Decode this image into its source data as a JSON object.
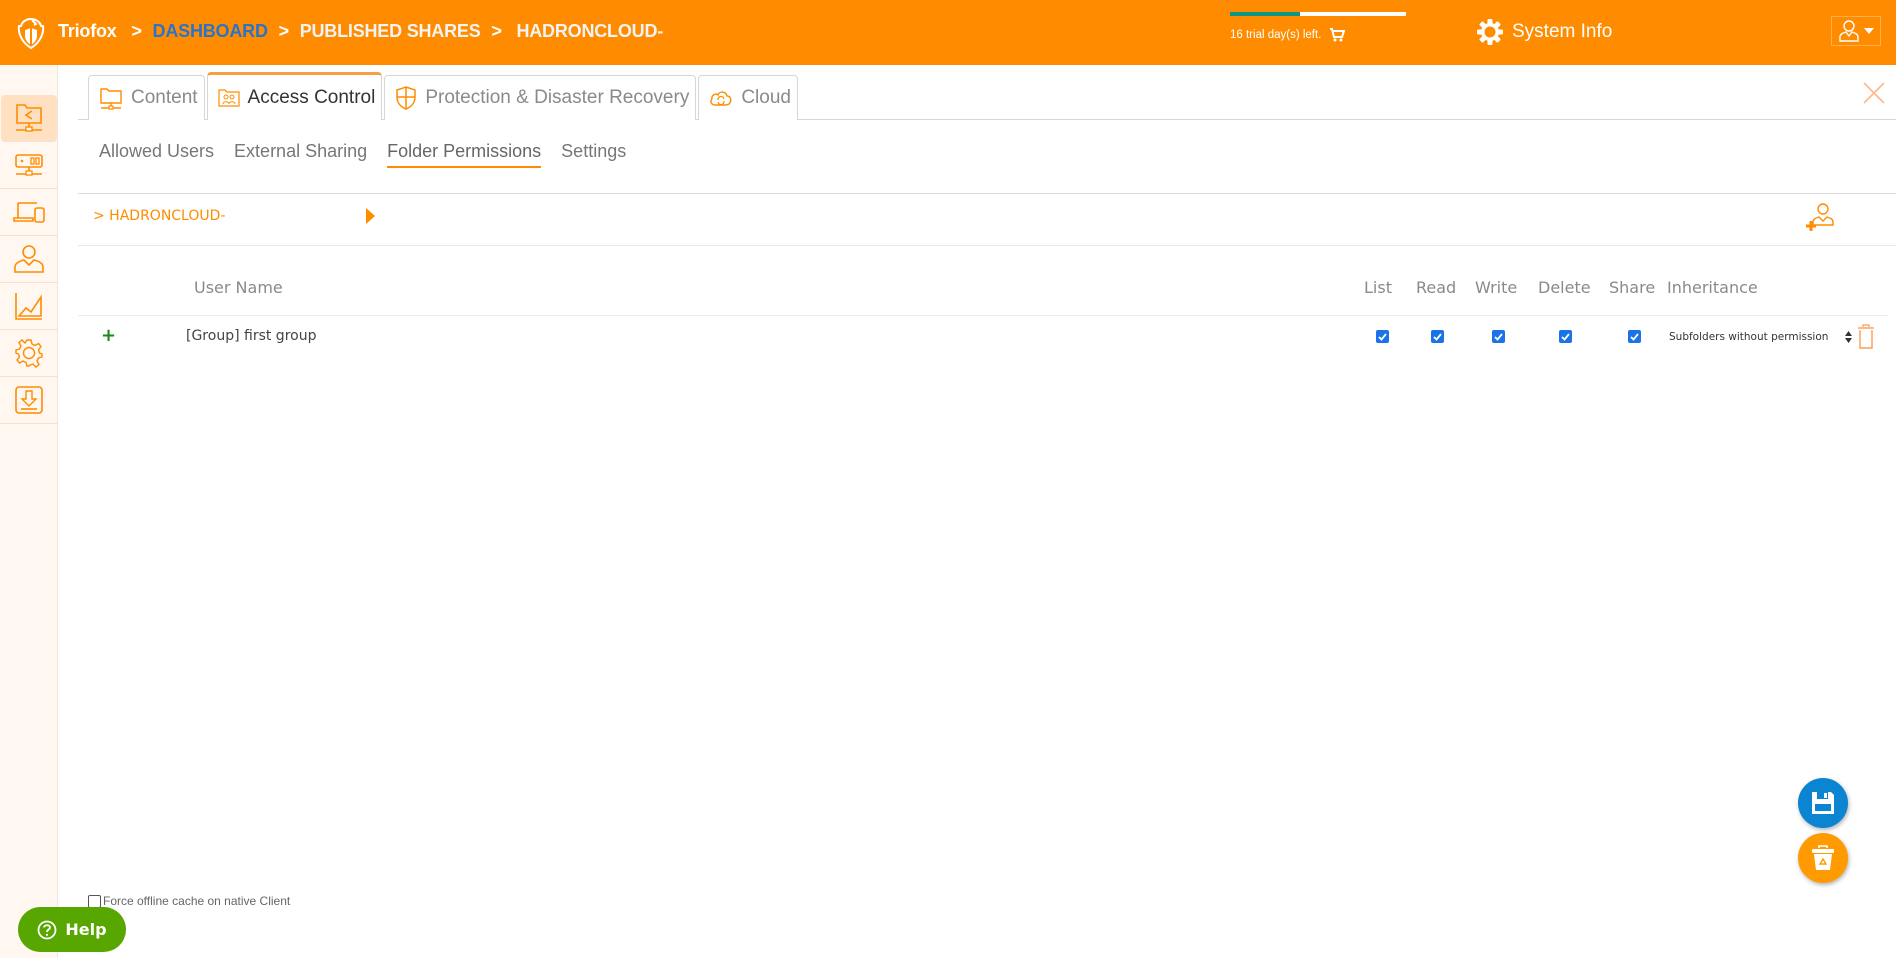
{
  "header": {
    "app_name": "Triofox",
    "breadcrumb": [
      {
        "label": "DASHBOARD",
        "link": true
      },
      {
        "label": "PUBLISHED SHARES",
        "link": false
      },
      {
        "label": "HADRONCLOUD-",
        "link": false
      }
    ],
    "separator": ">",
    "trial": {
      "text": "16 trial day(s) left.",
      "progress_fraction": 0.4
    },
    "system_info_label": "System Info",
    "icons": {
      "logo": "triofox-shield-logo",
      "cart": "cart-icon",
      "gear": "gear-icon",
      "user": "user-icon",
      "dropdown": "caret-down-icon"
    }
  },
  "sidebar": {
    "items": [
      {
        "name": "published-shares",
        "icon": "shared-folder-icon",
        "active": true
      },
      {
        "name": "storage",
        "icon": "server-icon",
        "active": false
      },
      {
        "name": "devices",
        "icon": "devices-icon",
        "active": false
      },
      {
        "name": "users",
        "icon": "user-icon",
        "active": false
      },
      {
        "name": "reports",
        "icon": "chart-icon",
        "active": false
      },
      {
        "name": "settings",
        "icon": "gear-icon",
        "active": false
      },
      {
        "name": "downloads",
        "icon": "download-icon",
        "active": false
      }
    ]
  },
  "tabs": [
    {
      "label": "Content",
      "icon": "folder-network-icon",
      "active": false
    },
    {
      "label": "Access Control",
      "icon": "users-folder-icon",
      "active": true
    },
    {
      "label": "Protection & Disaster Recovery",
      "icon": "shield-icon",
      "active": false
    },
    {
      "label": "Cloud",
      "icon": "cloud-sync-icon",
      "active": false
    }
  ],
  "subtabs": [
    {
      "label": "Allowed Users",
      "active": false
    },
    {
      "label": "External Sharing",
      "active": false
    },
    {
      "label": "Folder Permissions",
      "active": true
    },
    {
      "label": "Settings",
      "active": false
    }
  ],
  "folder_path": "> HADRONCLOUD-",
  "table": {
    "columns": [
      "User Name",
      "List",
      "Read",
      "Write",
      "Delete",
      "Share",
      "Inheritance"
    ],
    "rows": [
      {
        "user": "[Group] first group",
        "list": true,
        "read": true,
        "write": true,
        "delete": true,
        "share": true,
        "inheritance": "Subfolders without permission"
      }
    ]
  },
  "footer": {
    "offline_cache_label": "Force offline cache on native Client",
    "offline_cache_checked": false,
    "help_label": "Help"
  },
  "colors": {
    "brand_orange": "#ff8c00",
    "dashboard_link": "#2a73c9",
    "trial_fill": "#0e9685",
    "save_fab": "#0b84d1",
    "discard_fab": "#ff9a00",
    "help_green": "#58a700",
    "checkbox_blue": "#1a73e8"
  }
}
